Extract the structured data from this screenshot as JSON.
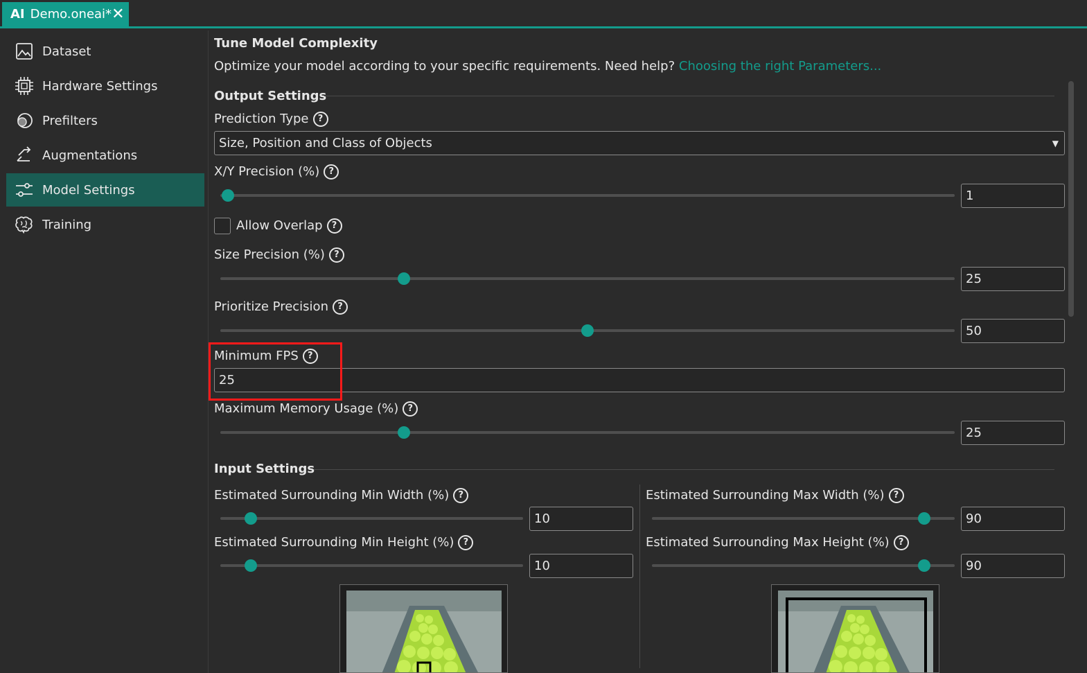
{
  "tab": {
    "badge": "AI",
    "title": "Demo.oneai*",
    "close": "✕"
  },
  "sidebar": {
    "items": [
      {
        "label": "Dataset",
        "icon": "image-icon"
      },
      {
        "label": "Hardware Settings",
        "icon": "chip-icon"
      },
      {
        "label": "Prefilters",
        "icon": "filter-circles-icon"
      },
      {
        "label": "Augmentations",
        "icon": "augment-icon"
      },
      {
        "label": "Model Settings",
        "icon": "sliders-icon",
        "active": true
      },
      {
        "label": "Training",
        "icon": "brain-icon"
      }
    ]
  },
  "main": {
    "title": "Tune Model Complexity",
    "description": "Optimize your model according to your specific requirements. Need help?",
    "help_link": "Choosing the right Parameters...",
    "output_section": "Output Settings",
    "prediction_type": {
      "label": "Prediction Type",
      "value": "Size, Position and Class of Objects"
    },
    "xy_precision": {
      "label": "X/Y Precision (%)",
      "value": "1",
      "level": 0.01
    },
    "allow_overlap": {
      "label": "Allow Overlap",
      "checked": false
    },
    "size_precision": {
      "label": "Size Precision (%)",
      "value": "25",
      "level": 0.25
    },
    "prioritize_precision": {
      "label": "Prioritize Precision",
      "value": "50",
      "level": 0.5
    },
    "minimum_fps": {
      "label": "Minimum FPS",
      "value": "25"
    },
    "max_memory": {
      "label": "Maximum Memory Usage (%)",
      "value": "25",
      "level": 0.25
    },
    "input_section": "Input Settings",
    "min_width": {
      "label": "Estimated Surrounding Min Width (%)",
      "value": "10",
      "level": 0.1
    },
    "min_height": {
      "label": "Estimated Surrounding Min Height (%)",
      "value": "10",
      "level": 0.1
    },
    "max_width": {
      "label": "Estimated Surrounding Max Width (%)",
      "value": "90",
      "level": 0.9
    },
    "max_height": {
      "label": "Estimated Surrounding Max Height (%)",
      "value": "90",
      "level": 0.9
    }
  },
  "colors": {
    "accent": "#139c8c",
    "active_nav": "#1a5d54",
    "highlight": "#ff1a1a",
    "background": "#2b2b2b"
  }
}
